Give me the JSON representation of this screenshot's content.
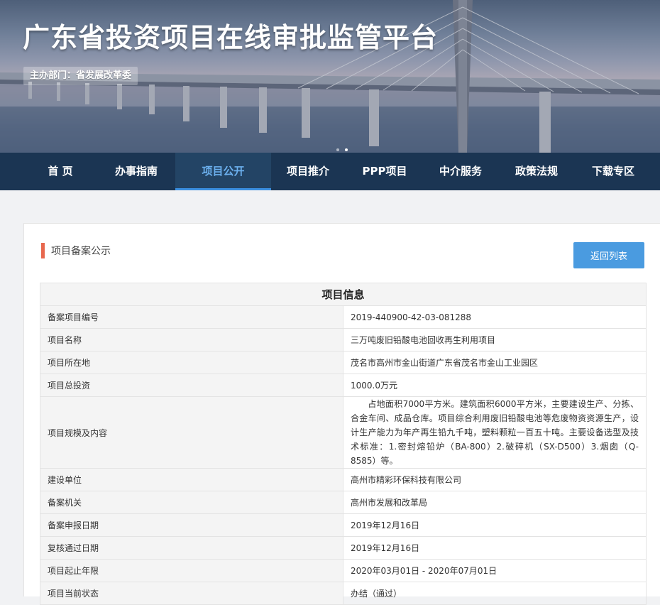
{
  "header": {
    "site_title": "广东省投资项目在线审批监管平台",
    "dept_badge": "主办部门：省发展改革委"
  },
  "banner": {
    "slide_count": 2,
    "active_slide": 2
  },
  "nav": {
    "items": [
      {
        "label": "首 页"
      },
      {
        "label": "办事指南"
      },
      {
        "label": "项目公开",
        "active": true
      },
      {
        "label": "项目推介"
      },
      {
        "label": "PPP项目"
      },
      {
        "label": "中介服务"
      },
      {
        "label": "政策法规"
      },
      {
        "label": "下载专区"
      }
    ]
  },
  "section": {
    "title": "项目备案公示",
    "back_button": "返回列表"
  },
  "table": {
    "caption": "项目信息",
    "rows": [
      {
        "label": "备案项目编号",
        "value": "2019-440900-42-03-081288"
      },
      {
        "label": "项目名称",
        "value": "三万吨废旧铅酸电池回收再生利用项目"
      },
      {
        "label": "项目所在地",
        "value": "茂名市高州市金山街道广东省茂名市金山工业园区"
      },
      {
        "label": "项目总投资",
        "value": "1000.0万元"
      },
      {
        "label": "项目规模及内容",
        "value": "占地面积7000平方米。建筑面积6000平方米，主要建设生产、分拣、合金车间、成品仓库。项目综合利用废旧铅酸电池等危废物资资源生产，设计生产能力为年产再生铅九千吨，塑料颗粒一百五十吨。主要设备选型及技术标准：1.密封熔铅炉（BA-800）2.破碎机（SX-D500）3.烟囱（Q-8585）等。"
      },
      {
        "label": "建设单位",
        "value": "高州市精彩环保科技有限公司"
      },
      {
        "label": "备案机关",
        "value": "高州市发展和改革局"
      },
      {
        "label": "备案申报日期",
        "value": "2019年12月16日"
      },
      {
        "label": "复核通过日期",
        "value": "2019年12月16日"
      },
      {
        "label": "项目起止年限",
        "value": "2020年03月01日 - 2020年07月01日"
      },
      {
        "label": "项目当前状态",
        "value": "办结（通过）"
      }
    ]
  },
  "colors": {
    "nav_bg": "#1b3553",
    "nav_active_text": "#6cb0ee",
    "nav_active_underline": "#3b8fe0",
    "accent_bar": "#e8684e",
    "button_bg": "#4a9be0",
    "page_bg": "#f1f2f4"
  }
}
